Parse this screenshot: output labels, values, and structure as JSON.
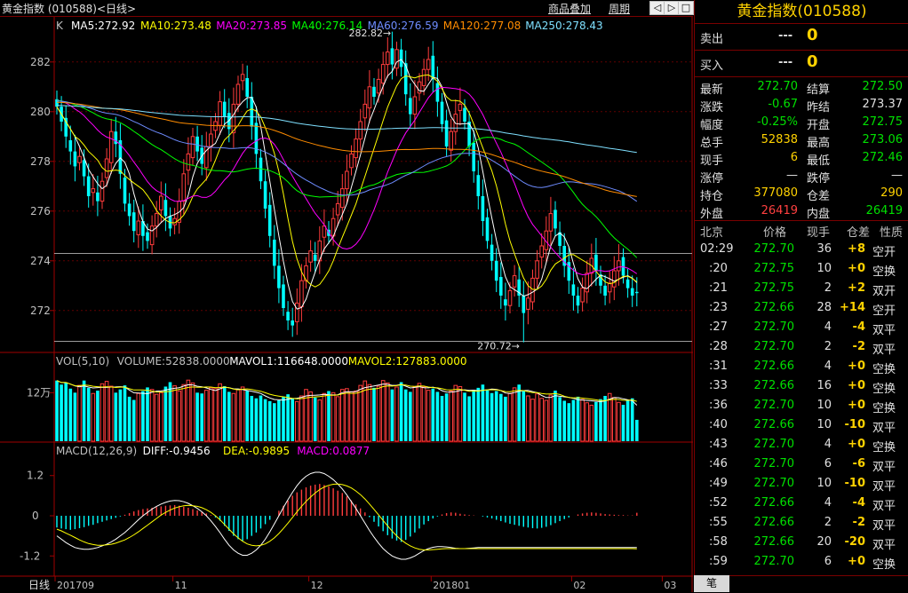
{
  "window": {
    "title": "黄金指数 (010588)<日线>",
    "link_overlay": "商品叠加",
    "link_period": "周期",
    "nav_buttons": [
      "◁",
      "▷",
      "□",
      "×"
    ]
  },
  "colors": {
    "up": "#ff3c3c",
    "down": "#00ffff",
    "ma5": "#ffffff",
    "ma10": "#ffff00",
    "ma20": "#ff00ff",
    "ma40": "#00ff00",
    "ma60": "#6e8cff",
    "ma120": "#ff8c00",
    "ma250": "#7fe0ff"
  },
  "chart_data": {
    "type": "candlestick",
    "price_panel": {
      "header": {
        "symbol": "K",
        "ma": [
          {
            "label": "MA5:272.92",
            "color": "#ffffff"
          },
          {
            "label": "MA10:273.48",
            "color": "#ffff00"
          },
          {
            "label": "MA20:273.85",
            "color": "#ff00ff"
          },
          {
            "label": "MA40:276.14",
            "color": "#00ff00"
          },
          {
            "label": "MA60:276.59",
            "color": "#6e8cff"
          },
          {
            "label": "MA120:277.08",
            "color": "#ff8c00"
          },
          {
            "label": "MA250:278.43",
            "color": "#7fe0ff"
          }
        ]
      },
      "y_ticks": [
        282,
        280,
        278,
        276,
        274,
        272
      ],
      "ylim": [
        270.6,
        283.6
      ],
      "high_label": "282.82→",
      "high_value": 282.82,
      "low_label": "270.72→",
      "low_value": 270.72,
      "current_price": 274.3
    },
    "volume_panel": {
      "header": [
        {
          "label": "VOL(5,10)",
          "color": "#c0c0c0"
        },
        {
          "label": "VOLUME:52838.0000",
          "color": "#c0c0c0"
        },
        {
          "label": "MAVOL1:116648.0000",
          "color": "#ffffff"
        },
        {
          "label": "MAVOL2:127883.0000",
          "color": "#ffff00"
        }
      ],
      "y_tick_label": "12万",
      "y_tick_value": 120000,
      "ymax": 180000
    },
    "macd_panel": {
      "header": [
        {
          "label": "MACD(12,26,9)",
          "color": "#c0c0c0"
        },
        {
          "label": "DIFF:-0.9456",
          "color": "#ffffff"
        },
        {
          "label": "DEA:-0.9895",
          "color": "#ffff00"
        },
        {
          "label": "MACD:0.0877",
          "color": "#ff00ff"
        }
      ],
      "y_ticks": [
        "1.2",
        "0",
        "-1.2"
      ],
      "y_tick_values": [
        1.2,
        0,
        -1.2
      ],
      "ylim": [
        -1.75,
        1.75
      ]
    },
    "x_axis": {
      "period_label": "日线",
      "labels": [
        {
          "text": "201709",
          "idx": 0
        },
        {
          "text": "11",
          "idx": 26
        },
        {
          "text": "12",
          "idx": 56
        },
        {
          "text": "201801",
          "idx": 83
        },
        {
          "text": "02",
          "idx": 114
        },
        {
          "text": "03",
          "idx": 134
        }
      ]
    },
    "close": [
      280.2,
      279.6,
      279.0,
      278.4,
      277.8,
      278.2,
      277.4,
      276.6,
      276.9,
      276.4,
      277.2,
      278.1,
      279.2,
      278.7,
      277.5,
      276.3,
      275.8,
      275.2,
      275.6,
      275.0,
      274.8,
      275.4,
      275.9,
      276.6,
      275.8,
      275.3,
      275.7,
      276.4,
      277.5,
      278.3,
      279.0,
      278.4,
      277.9,
      278.6,
      279.1,
      279.6,
      280.4,
      279.8,
      279.3,
      280.3,
      281.1,
      281.5,
      280.6,
      279.4,
      278.3,
      277.2,
      276.1,
      275.0,
      273.8,
      272.9,
      272.1,
      271.6,
      271.4,
      272.3,
      273.2,
      273.8,
      274.4,
      274.0,
      274.8,
      275.4,
      275.0,
      275.7,
      276.3,
      276.9,
      277.6,
      278.3,
      278.9,
      279.6,
      280.3,
      281.0,
      280.6,
      281.3,
      281.9,
      282.4,
      281.9,
      282.5,
      281.8,
      280.7,
      279.9,
      280.6,
      281.2,
      281.7,
      282.1,
      281.3,
      280.4,
      279.5,
      278.6,
      279.2,
      279.9,
      280.3,
      279.6,
      278.6,
      277.6,
      276.6,
      275.6,
      274.8,
      274.0,
      273.2,
      272.6,
      272.2,
      272.8,
      273.4,
      272.6,
      271.9,
      272.5,
      273.3,
      274.0,
      274.6,
      275.2,
      275.9,
      275.3,
      274.6,
      273.8,
      273.2,
      272.6,
      272.2,
      272.9,
      273.5,
      274.1,
      273.6,
      273.0,
      272.6,
      273.1,
      273.6,
      274.0,
      273.4,
      272.9,
      272.6,
      272.7
    ],
    "volume": [
      150000,
      140000,
      145000,
      130000,
      120000,
      138000,
      150000,
      132000,
      118000,
      125000,
      142000,
      148000,
      136000,
      120000,
      128000,
      138000,
      110000,
      102000,
      118000,
      124000,
      133000,
      128000,
      116000,
      120000,
      135000,
      146000,
      137000,
      124000,
      140000,
      151000,
      144000,
      120000,
      118000,
      126000,
      132000,
      130000,
      142000,
      136000,
      122000,
      118000,
      128000,
      134000,
      125000,
      112000,
      106000,
      113000,
      104000,
      99000,
      94000,
      101000,
      110000,
      116000,
      106000,
      98000,
      112000,
      128000,
      122000,
      108000,
      102000,
      118000,
      124000,
      120000,
      110000,
      128000,
      130000,
      122000,
      124000,
      138000,
      149000,
      140000,
      132000,
      136000,
      150000,
      144000,
      128000,
      134000,
      146000,
      128000,
      122000,
      135000,
      143000,
      134000,
      126000,
      130000,
      122000,
      112000,
      118000,
      124000,
      138000,
      135000,
      120000,
      111000,
      127000,
      132000,
      140000,
      126000,
      119000,
      124000,
      117000,
      110000,
      118000,
      132000,
      140000,
      126000,
      112000,
      104000,
      117000,
      106000,
      101000,
      114000,
      125000,
      109000,
      100000,
      94000,
      102000,
      110000,
      103000,
      95000,
      89000,
      97000,
      104000,
      112000,
      118000,
      108000,
      96000,
      90000,
      100000,
      106000,
      52838
    ],
    "macd_hist": [
      -0.35,
      -0.38,
      -0.4,
      -0.42,
      -0.4,
      -0.37,
      -0.34,
      -0.3,
      -0.27,
      -0.22,
      -0.18,
      -0.14,
      -0.1,
      -0.06,
      -0.02,
      0.03,
      0.08,
      0.13,
      0.17,
      0.2,
      0.22,
      0.24,
      0.26,
      0.28,
      0.3,
      0.31,
      0.32,
      0.3,
      0.27,
      0.24,
      0.2,
      0.16,
      0.12,
      0.07,
      0.02,
      -0.05,
      -0.15,
      -0.3,
      -0.45,
      -0.6,
      -0.7,
      -0.75,
      -0.7,
      -0.6,
      -0.5,
      -0.38,
      -0.25,
      -0.12,
      0.0,
      0.15,
      0.3,
      0.45,
      0.6,
      0.7,
      0.78,
      0.85,
      0.9,
      0.93,
      0.95,
      0.92,
      0.88,
      0.82,
      0.75,
      0.68,
      0.58,
      0.46,
      0.34,
      0.22,
      0.1,
      -0.04,
      -0.18,
      -0.32,
      -0.46,
      -0.58,
      -0.68,
      -0.74,
      -0.78,
      -0.72,
      -0.62,
      -0.5,
      -0.38,
      -0.26,
      -0.16,
      -0.08,
      -0.02,
      0.04,
      0.08,
      0.1,
      0.09,
      0.06,
      0.04,
      0.02,
      0.01,
      0.0,
      -0.02,
      -0.05,
      -0.08,
      -0.12,
      -0.16,
      -0.2,
      -0.24,
      -0.27,
      -0.3,
      -0.33,
      -0.35,
      -0.37,
      -0.38,
      -0.36,
      -0.33,
      -0.28,
      -0.22,
      -0.16,
      -0.1,
      -0.05,
      0.0,
      0.04,
      0.07,
      0.09,
      0.1,
      0.09,
      0.07,
      0.05,
      0.04,
      0.03,
      0.02,
      0.02,
      0.01,
      0.01,
      0.09
    ],
    "diff": [
      -0.6,
      -0.7,
      -0.8,
      -0.88,
      -0.95,
      -0.98,
      -1.0,
      -1.0,
      -0.98,
      -0.95,
      -0.9,
      -0.85,
      -0.78,
      -0.7,
      -0.6,
      -0.5,
      -0.38,
      -0.25,
      -0.12,
      0.0,
      0.1,
      0.2,
      0.28,
      0.35,
      0.4,
      0.44,
      0.46,
      0.45,
      0.42,
      0.37,
      0.3,
      0.22,
      0.12,
      0.0,
      -0.15,
      -0.32,
      -0.5,
      -0.7,
      -0.88,
      -1.02,
      -1.12,
      -1.18,
      -1.18,
      -1.12,
      -1.02,
      -0.88,
      -0.7,
      -0.48,
      -0.24,
      0.0,
      0.25,
      0.48,
      0.7,
      0.9,
      1.06,
      1.18,
      1.26,
      1.3,
      1.3,
      1.26,
      1.18,
      1.08,
      0.95,
      0.8,
      0.62,
      0.42,
      0.22,
      0.0,
      -0.22,
      -0.44,
      -0.64,
      -0.82,
      -0.98,
      -1.1,
      -1.2,
      -1.26,
      -1.3,
      -1.3,
      -1.26,
      -1.2,
      -1.12,
      -1.04,
      -0.98,
      -0.94,
      -0.92,
      -0.92,
      -0.93,
      -0.95,
      -0.97,
      -0.98,
      -0.98,
      -0.97,
      -0.96,
      -0.95,
      -0.95,
      -0.95,
      -0.95,
      -0.95,
      -0.95,
      -0.95,
      -0.95,
      -0.95,
      -0.95,
      -0.95,
      -0.95,
      -0.95,
      -0.95,
      -0.95,
      -0.95,
      -0.95,
      -0.95,
      -0.95,
      -0.95,
      -0.95,
      -0.95,
      -0.95,
      -0.95,
      -0.95,
      -0.95,
      -0.95,
      -0.95,
      -0.95,
      -0.95,
      -0.95,
      -0.95,
      -0.95,
      -0.95,
      -0.95,
      -0.9456
    ],
    "dea": [
      -0.4,
      -0.45,
      -0.52,
      -0.58,
      -0.65,
      -0.72,
      -0.78,
      -0.83,
      -0.86,
      -0.88,
      -0.88,
      -0.87,
      -0.85,
      -0.82,
      -0.77,
      -0.72,
      -0.65,
      -0.57,
      -0.48,
      -0.38,
      -0.28,
      -0.18,
      -0.08,
      0.02,
      0.1,
      0.17,
      0.23,
      0.27,
      0.3,
      0.31,
      0.3,
      0.28,
      0.24,
      0.18,
      0.1,
      0.0,
      -0.12,
      -0.26,
      -0.4,
      -0.54,
      -0.66,
      -0.76,
      -0.84,
      -0.88,
      -0.9,
      -0.88,
      -0.84,
      -0.76,
      -0.66,
      -0.53,
      -0.38,
      -0.22,
      -0.05,
      0.12,
      0.28,
      0.43,
      0.56,
      0.68,
      0.78,
      0.86,
      0.91,
      0.94,
      0.95,
      0.93,
      0.89,
      0.83,
      0.74,
      0.63,
      0.5,
      0.35,
      0.19,
      0.03,
      -0.14,
      -0.3,
      -0.46,
      -0.6,
      -0.72,
      -0.82,
      -0.9,
      -0.96,
      -1.0,
      -1.02,
      -1.02,
      -1.01,
      -1.0,
      -0.99,
      -0.98,
      -0.98,
      -0.98,
      -0.98,
      -0.98,
      -0.98,
      -0.98,
      -0.98,
      -0.98,
      -0.98,
      -0.98,
      -0.98,
      -0.98,
      -0.98,
      -0.98,
      -0.98,
      -0.98,
      -0.98,
      -0.98,
      -0.98,
      -0.98,
      -0.98,
      -0.98,
      -0.98,
      -0.98,
      -0.98,
      -0.98,
      -0.98,
      -0.98,
      -0.98,
      -0.98,
      -0.98,
      -0.98,
      -0.98,
      -0.98,
      -0.98,
      -0.98,
      -0.98,
      -0.98,
      -0.98,
      -0.98,
      -0.98,
      -0.9895
    ]
  },
  "quote": {
    "title": "黄金指数(010588)",
    "sell_label": "卖出",
    "sell_price": "---",
    "sell_vol": "0",
    "buy_label": "买入",
    "buy_price": "---",
    "buy_vol": "0",
    "rows": [
      {
        "l1": "最新",
        "v1": "272.70",
        "c1": "green",
        "l2": "结算",
        "v2": "272.50",
        "c2": "green"
      },
      {
        "l1": "涨跌",
        "v1": "-0.67",
        "c1": "green",
        "l2": "昨结",
        "v2": "273.37",
        "c2": "wht"
      },
      {
        "l1": "幅度",
        "v1": "-0.25%",
        "c1": "green",
        "l2": "开盘",
        "v2": "272.75",
        "c2": "green"
      },
      {
        "l1": "总手",
        "v1": "52838",
        "c1": "yel",
        "l2": "最高",
        "v2": "273.06",
        "c2": "green"
      },
      {
        "l1": "现手",
        "v1": "6",
        "c1": "yel",
        "l2": "最低",
        "v2": "272.46",
        "c2": "green"
      },
      {
        "l1": "涨停",
        "v1": "—",
        "c1": "wht",
        "l2": "跌停",
        "v2": "—",
        "c2": "wht"
      },
      {
        "l1": "持仓",
        "v1": "377080",
        "c1": "yel",
        "l2": "仓差",
        "v2": "290",
        "c2": "yel"
      },
      {
        "l1": "外盘",
        "v1": "26419",
        "c1": "red",
        "l2": "内盘",
        "v2": "26419",
        "c2": "green"
      }
    ]
  },
  "ticks": {
    "headers": [
      "北京",
      "价格",
      "现手",
      "仓差",
      "性质"
    ],
    "rows": [
      {
        "time": "02:29",
        "price": "272.70",
        "vol": "36",
        "diff": "+8",
        "dcolor": "yel",
        "nature": "空开"
      },
      {
        "time": ":20",
        "price": "272.75",
        "vol": "10",
        "diff": "+0",
        "dcolor": "yel",
        "nature": "空换"
      },
      {
        "time": ":21",
        "price": "272.75",
        "vol": "2",
        "diff": "+2",
        "dcolor": "yel",
        "nature": "双开"
      },
      {
        "time": ":23",
        "price": "272.66",
        "vol": "28",
        "diff": "+14",
        "dcolor": "yel",
        "nature": "空开"
      },
      {
        "time": ":27",
        "price": "272.70",
        "vol": "4",
        "diff": "-4",
        "dcolor": "yel",
        "nature": "双平"
      },
      {
        "time": ":28",
        "price": "272.70",
        "vol": "2",
        "diff": "-2",
        "dcolor": "yel",
        "nature": "双平"
      },
      {
        "time": ":31",
        "price": "272.66",
        "vol": "4",
        "diff": "+0",
        "dcolor": "yel",
        "nature": "空换"
      },
      {
        "time": ":33",
        "price": "272.66",
        "vol": "16",
        "diff": "+0",
        "dcolor": "yel",
        "nature": "空换"
      },
      {
        "time": ":36",
        "price": "272.70",
        "vol": "10",
        "diff": "+0",
        "dcolor": "yel",
        "nature": "空换"
      },
      {
        "time": ":40",
        "price": "272.66",
        "vol": "10",
        "diff": "-10",
        "dcolor": "yel",
        "nature": "双平"
      },
      {
        "time": ":43",
        "price": "272.70",
        "vol": "4",
        "diff": "+0",
        "dcolor": "yel",
        "nature": "空换"
      },
      {
        "time": ":46",
        "price": "272.70",
        "vol": "6",
        "diff": "-6",
        "dcolor": "yel",
        "nature": "双平"
      },
      {
        "time": ":49",
        "price": "272.70",
        "vol": "10",
        "diff": "-10",
        "dcolor": "yel",
        "nature": "双平"
      },
      {
        "time": ":52",
        "price": "272.66",
        "vol": "4",
        "diff": "-4",
        "dcolor": "yel",
        "nature": "双平"
      },
      {
        "time": ":55",
        "price": "272.66",
        "vol": "2",
        "diff": "-2",
        "dcolor": "yel",
        "nature": "双平"
      },
      {
        "time": ":58",
        "price": "272.66",
        "vol": "20",
        "diff": "-20",
        "dcolor": "yel",
        "nature": "双平"
      },
      {
        "time": ":59",
        "price": "272.70",
        "vol": "6",
        "diff": "+0",
        "dcolor": "yel",
        "nature": "空换"
      }
    ]
  },
  "bottom": {
    "tab_label": "笔"
  }
}
